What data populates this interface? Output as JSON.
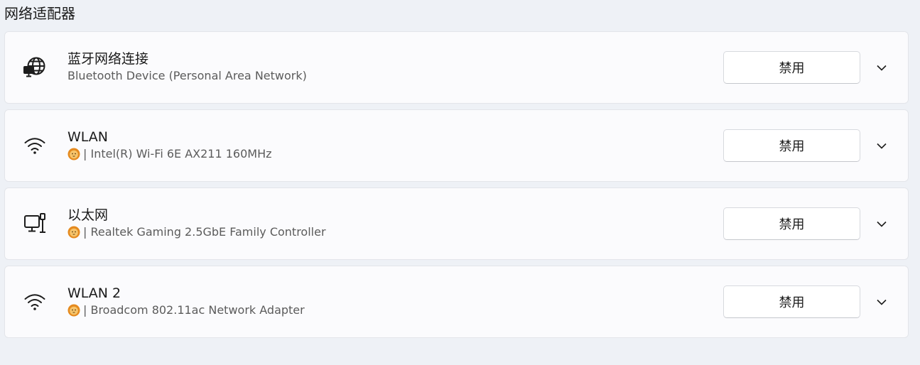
{
  "section": {
    "title": "网络适配器"
  },
  "adapters": [
    {
      "icon": "globe-computer-icon",
      "name": "蓝牙网络连接",
      "desc": "Bluetooth Device (Personal Area Network)",
      "has_lion": false,
      "button_label": "禁用"
    },
    {
      "icon": "wifi-icon",
      "name": "WLAN",
      "desc": "| Intel(R) Wi-Fi 6E AX211 160MHz",
      "has_lion": true,
      "button_label": "禁用"
    },
    {
      "icon": "ethernet-icon",
      "name": "以太网",
      "desc": "| Realtek Gaming 2.5GbE Family Controller",
      "has_lion": true,
      "button_label": "禁用"
    },
    {
      "icon": "wifi-icon",
      "name": "WLAN 2",
      "desc": "| Broadcom 802.11ac Network Adapter",
      "has_lion": true,
      "button_label": "禁用"
    }
  ],
  "colors": {
    "background": "#eef1f6",
    "card": "#fbfbfd",
    "lion": "#f2a23a"
  }
}
